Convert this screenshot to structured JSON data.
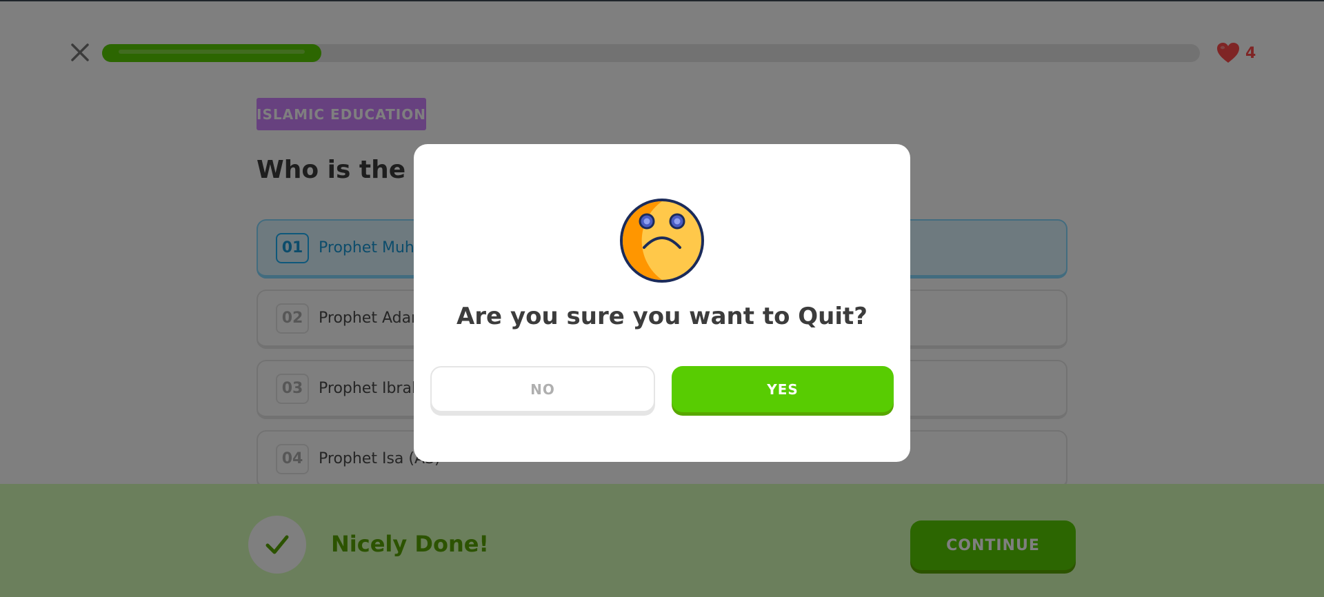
{
  "header": {
    "close_icon": "close-icon",
    "progress": 0.2,
    "hearts_icon": "heart-icon",
    "hearts_count": "4"
  },
  "subject": {
    "badge": "ISLAMIC EDUCATION"
  },
  "question": {
    "text": "Who is the last prophet sent by Allah?"
  },
  "options": [
    {
      "num": "01",
      "label": "Prophet Muhammad (SAW)",
      "selected": true
    },
    {
      "num": "02",
      "label": "Prophet Adam (AS)",
      "selected": false
    },
    {
      "num": "03",
      "label": "Prophet Ibrahim (AS)",
      "selected": false
    },
    {
      "num": "04",
      "label": "Prophet Isa (AS)",
      "selected": false
    }
  ],
  "footer": {
    "icon": "check-icon",
    "message": "Nicely Done!",
    "continue_label": "CONTINUE"
  },
  "modal": {
    "icon": "sad-face-icon",
    "title": "Are you sure you want to Quit?",
    "no_label": "NO",
    "yes_label": "YES"
  },
  "colors": {
    "accent_green": "#58cc02",
    "badge_purple": "#ce82ff",
    "heart_red": "#ff4b4b",
    "selected_blue": "#1cb0f6"
  }
}
